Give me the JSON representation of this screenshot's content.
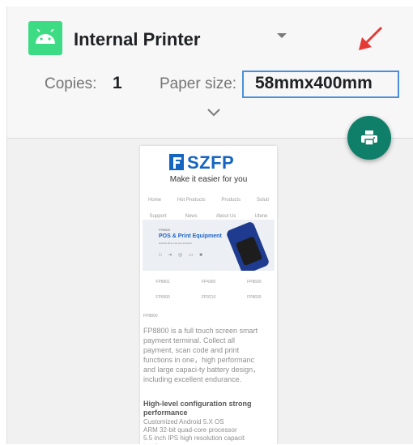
{
  "header": {
    "printer_name": "Internal Printer",
    "copies_label": "Copies:",
    "copies_value": "1",
    "paper_size_label": "Paper size:",
    "paper_size_value": "58mmx400mm"
  },
  "icons": {
    "app": "android-icon",
    "dropdown": "dropdown-arrow-icon",
    "expand": "chevron-down-icon",
    "print": "print-icon",
    "annotation": "red-arrow-icon"
  },
  "colors": {
    "android_green": "#3ddc84",
    "fab": "#0f7f69",
    "highlight_border": "#4a90d9",
    "annotation_arrow": "#e53935",
    "brand_blue": "#1565c0"
  },
  "preview": {
    "logo_text": "SZFP",
    "slogan": "Make it easier for you",
    "nav_row1": [
      "Home",
      "Hot Products",
      "Products",
      "Soluti"
    ],
    "nav_row2": [
      "Support",
      "News",
      "About Us",
      "Utene"
    ],
    "banner": {
      "line1": "FP8800",
      "title": "POS & Print Equipment",
      "line3": "android all-in-one pos terminal"
    },
    "models_row1": [
      "FP8801",
      "FP4300",
      "FP8600"
    ],
    "models_row2": [
      "FP9000",
      "FP9210",
      "FP8600"
    ],
    "small_label": "FP8800",
    "description": "FP8800 is a full touch screen smart\npayment terminal. Collect all\npayment, scan code and print\nfunctions in one，high performanc\nand large capaci-ty battery design，\nincluding excellent endurance.",
    "feature_title": "High-level configuration strong\nperformance",
    "feature_desc": "Customized Android 5.X OS\nARM 32-bit quad-core processor\n5.5 inch IPS high resolution capacit\ntouch screen"
  }
}
